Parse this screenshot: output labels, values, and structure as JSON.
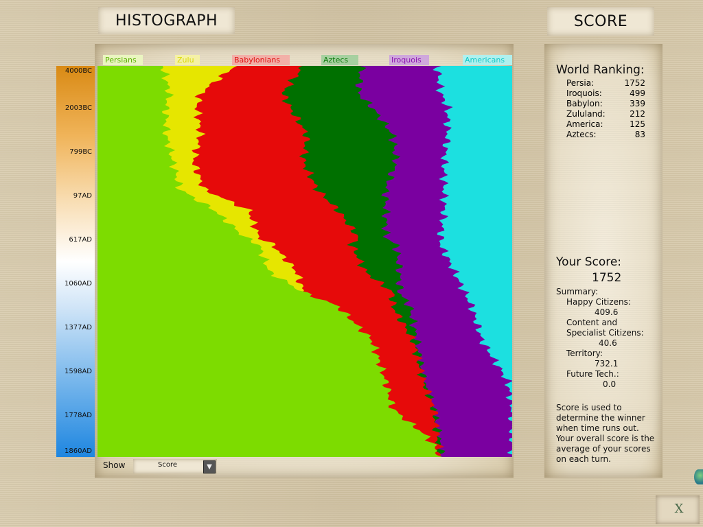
{
  "titles": {
    "histograph": "HISTOGRAPH",
    "score": "SCORE"
  },
  "timeline": [
    "4000BC",
    "2003BC",
    "799BC",
    "97AD",
    "617AD",
    "1060AD",
    "1377AD",
    "1598AD",
    "1778AD",
    "1860AD"
  ],
  "legend": [
    {
      "name": "Persians",
      "color": "#7ddc00",
      "text_color": "#5ab000"
    },
    {
      "name": "Zulu",
      "color": "#e6e600",
      "text_color": "#d8d800"
    },
    {
      "name": "Babylonians",
      "color": "#e60a0a",
      "text_color": "#e01010"
    },
    {
      "name": "Aztecs",
      "color": "#007000",
      "text_color": "#0a7a0a"
    },
    {
      "name": "Iroquois",
      "color": "#7a00a0",
      "text_color": "#8a10b0"
    },
    {
      "name": "Americans",
      "color": "#1ce0e0",
      "text_color": "#10c8c8"
    }
  ],
  "show": {
    "label": "Show",
    "value": "Score"
  },
  "ranking": {
    "heading": "World Ranking:",
    "rows": [
      {
        "name": "Persia:",
        "value": "1752"
      },
      {
        "name": "Iroquois:",
        "value": "499"
      },
      {
        "name": "Babylon:",
        "value": "339"
      },
      {
        "name": "Zululand:",
        "value": "212"
      },
      {
        "name": "America:",
        "value": "125"
      },
      {
        "name": "Aztecs:",
        "value": "83"
      }
    ]
  },
  "your_score": {
    "heading": "Your Score:",
    "value": "1752",
    "summary_label": "Summary:",
    "happy_label": "Happy Citizens:",
    "happy_value": "409.6",
    "content_label_1": "Content and",
    "content_label_2": "Specialist Citizens:",
    "content_value": "40.6",
    "territory_label": "Territory:",
    "territory_value": "732.1",
    "future_label": "Future Tech.:",
    "future_value": "0.0"
  },
  "note": [
    "Score is used to",
    "determine the winner",
    "when time runs out.",
    "Your overall score is the",
    "average of your scores",
    "on each turn."
  ],
  "close_label": "X"
}
